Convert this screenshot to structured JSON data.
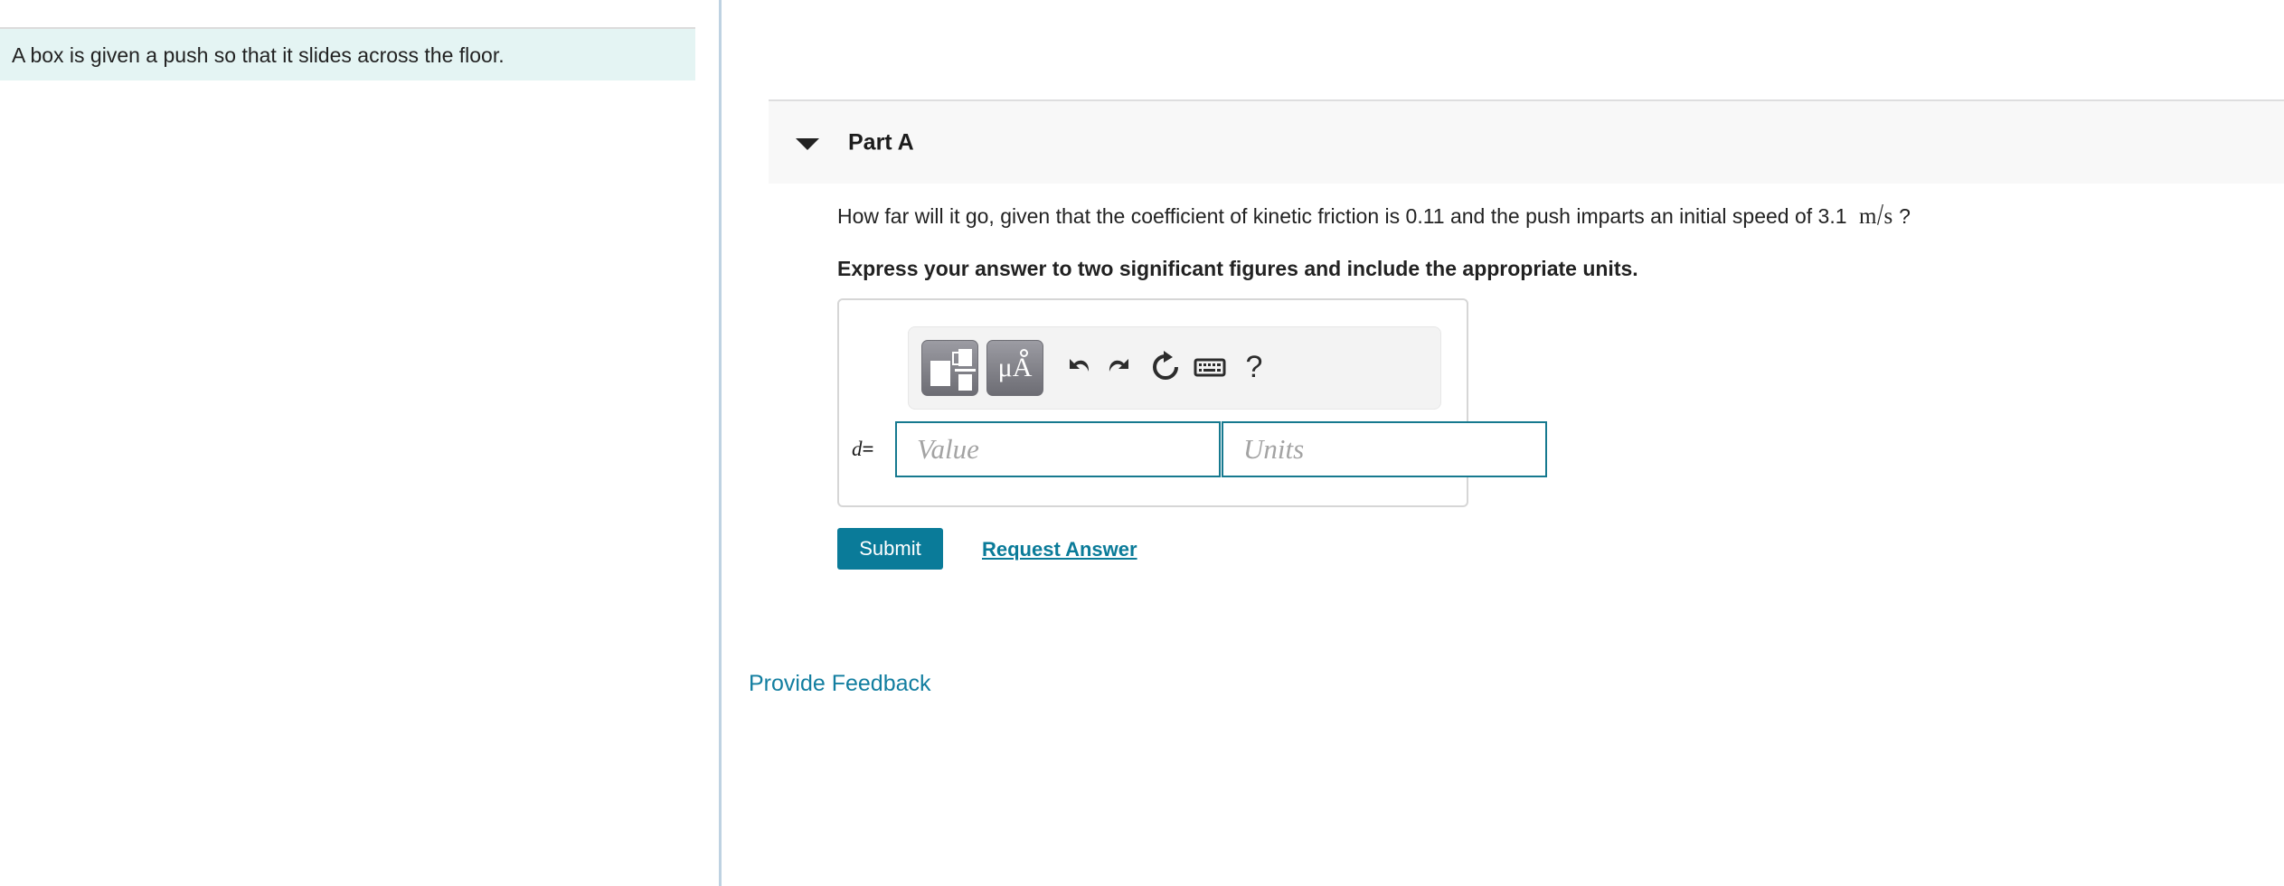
{
  "left_panel": {
    "problem_statement": "A box is given a push so that it slides across the floor."
  },
  "right_panel": {
    "part": {
      "title": "Part A",
      "toggle_icon": "triangle-down-icon",
      "expanded": true
    },
    "question": {
      "text_before_units": "How far will it go, given that the coefficient of kinetic friction is 0.11 and the push imparts an initial speed of 3.1",
      "unit_numerator": "m",
      "unit_slash": "/",
      "unit_denominator": "s",
      "text_after_units": "?",
      "coefficient_of_kinetic_friction": "0.11",
      "initial_speed": "3.1",
      "initial_speed_units": "m/s"
    },
    "instruction": "Express your answer to two significant figures and include the appropriate units.",
    "answer_box": {
      "toolbar": {
        "buttons": [
          {
            "name": "math-template",
            "label": "template-icon"
          },
          {
            "name": "units",
            "label": "μÅ"
          }
        ],
        "icons": [
          {
            "name": "undo-icon",
            "label": "Undo"
          },
          {
            "name": "redo-icon",
            "label": "Redo"
          },
          {
            "name": "reset-icon",
            "label": "Reset"
          },
          {
            "name": "keyboard-icon",
            "label": "Keyboard"
          },
          {
            "name": "help-icon",
            "label": "?"
          }
        ]
      },
      "variable_label": "d",
      "equals_sign": "=",
      "value_input": {
        "value": "",
        "placeholder": "Value"
      },
      "units_input": {
        "value": "",
        "placeholder": "Units"
      }
    },
    "actions": {
      "submit_label": "Submit",
      "request_answer_label": "Request Answer",
      "provide_feedback_label": "Provide Feedback"
    }
  },
  "colors": {
    "accent_teal": "#0a7b99",
    "link_teal": "#127ea0",
    "input_border": "#16798f",
    "highlight_bg": "#e4f4f3",
    "header_bg": "#f8f8f8",
    "divider": "#bed2e2"
  }
}
